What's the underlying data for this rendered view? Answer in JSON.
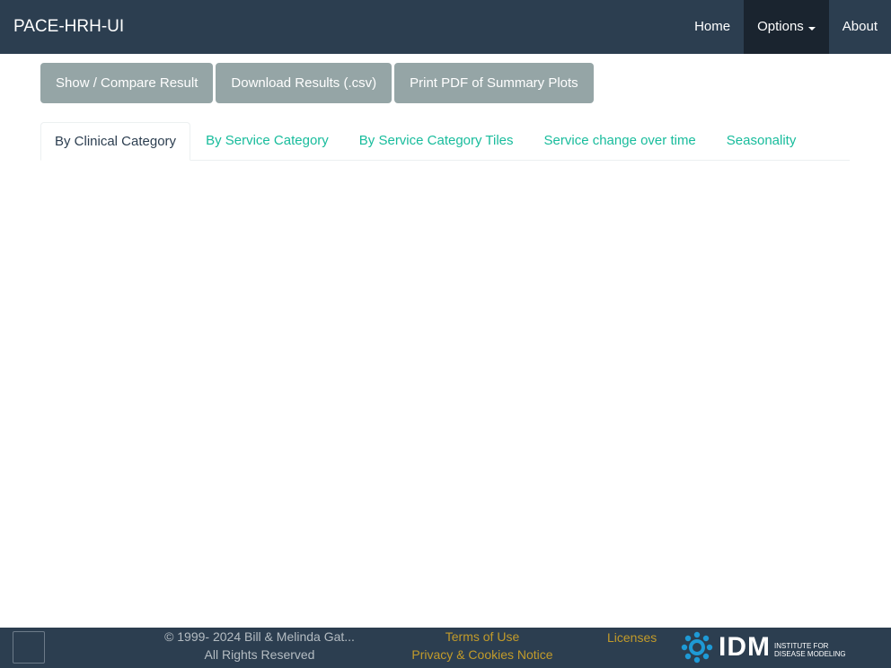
{
  "navbar": {
    "brand": "PACE-HRH-UI",
    "items": [
      {
        "label": "Home"
      },
      {
        "label": "Options"
      },
      {
        "label": "About"
      }
    ]
  },
  "actions": [
    {
      "label": "Show / Compare Result"
    },
    {
      "label": "Download Results (.csv)"
    },
    {
      "label": "Print PDF of Summary Plots"
    }
  ],
  "tabs": [
    {
      "label": "By Clinical Category",
      "active": true
    },
    {
      "label": "By Service Category"
    },
    {
      "label": "By Service Category Tiles"
    },
    {
      "label": "Service change over time"
    },
    {
      "label": "Seasonality"
    }
  ],
  "footer": {
    "copyright_line1": "© 1999- 2024 Bill & Melinda Gat...",
    "copyright_line2": "All Rights Reserved",
    "terms": "Terms of Use",
    "privacy": "Privacy & Cookies Notice",
    "licenses": "Licenses",
    "logo_text": "IDM",
    "logo_sub1": "INSTITUTE FOR",
    "logo_sub2": "DISEASE MODELING"
  },
  "colors": {
    "navbar_bg": "#2c3e50",
    "navbar_active_bg": "#1a242f",
    "button_bg": "#95a5a6",
    "tab_link": "#18bc9c",
    "footer_link": "#c29b2a",
    "logo_blue": "#1e9ad6"
  }
}
